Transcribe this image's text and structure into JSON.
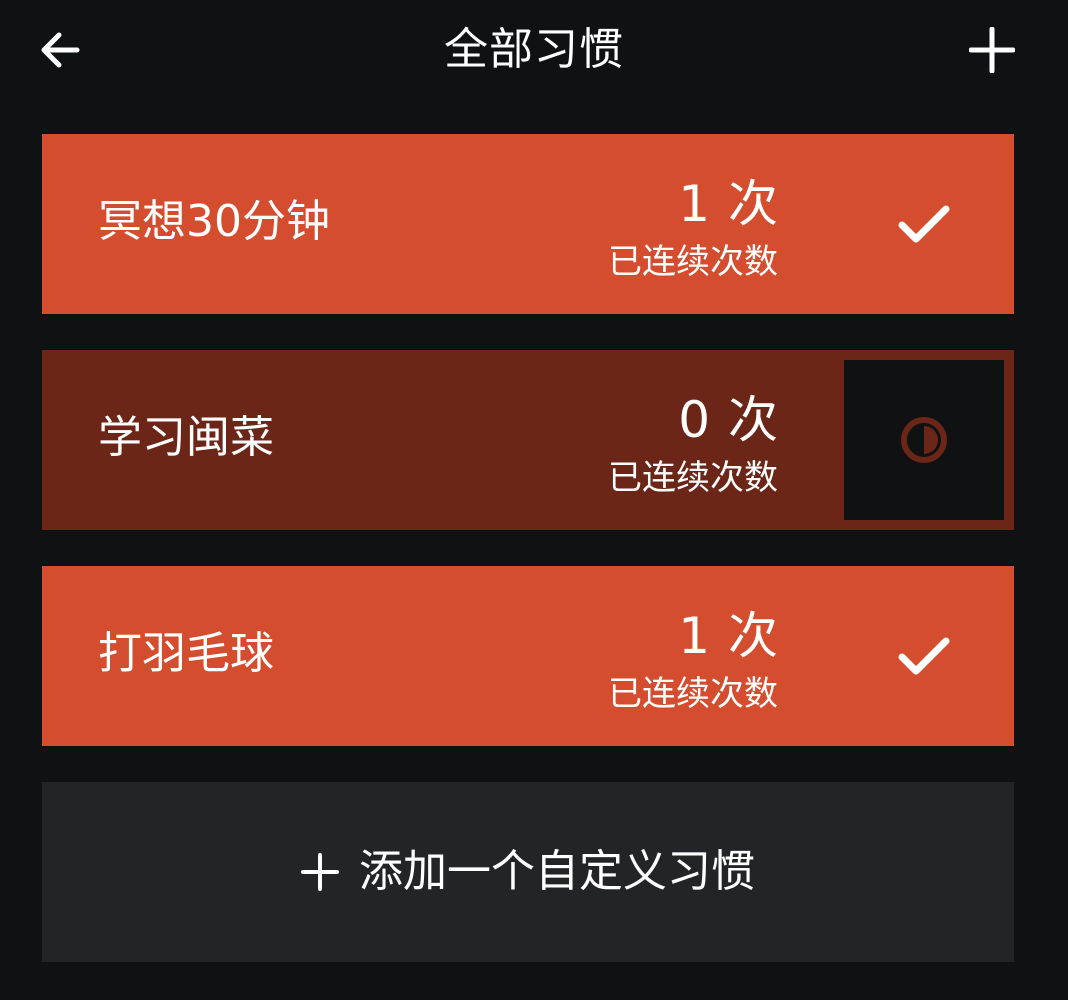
{
  "header": {
    "title": "全部习惯",
    "back_icon": "arrow-left-icon",
    "add_icon": "plus-icon"
  },
  "habits": [
    {
      "name": "冥想30分钟",
      "count": "1",
      "unit": "次",
      "streak_label": "已连续次数",
      "status": "done",
      "status_icon": "checkmark-icon"
    },
    {
      "name": "学习闽菜",
      "count": "0",
      "unit": "次",
      "streak_label": "已连续次数",
      "status": "pending",
      "status_icon": "half-circle-icon"
    },
    {
      "name": "打羽毛球",
      "count": "1",
      "unit": "次",
      "streak_label": "已连续次数",
      "status": "done",
      "status_icon": "checkmark-icon"
    }
  ],
  "add_custom": {
    "label": "添加一个自定义习惯",
    "icon": "plus-icon"
  },
  "colors": {
    "background": "#0f1113",
    "card_active": "#d44d2e",
    "card_inactive": "#6b2617",
    "add_card": "#232426",
    "pending_icon": "#6b2617",
    "text": "#ffffff"
  }
}
